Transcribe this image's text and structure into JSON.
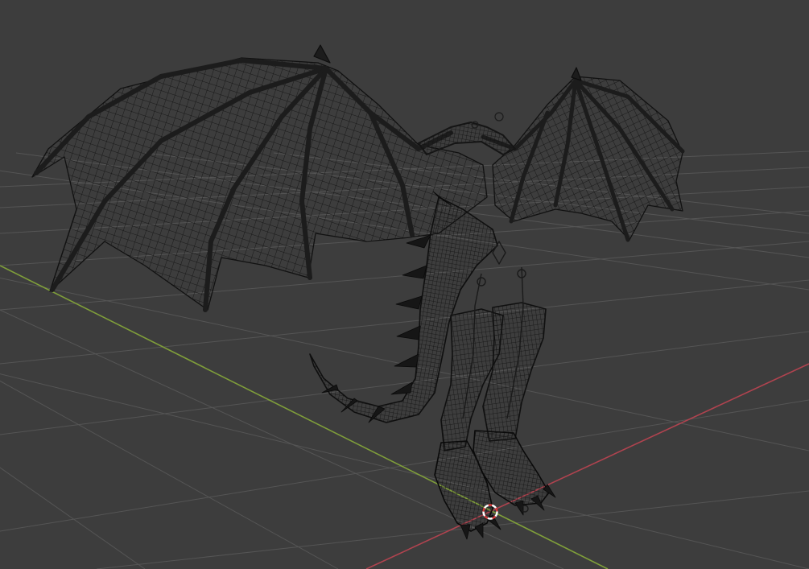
{
  "viewport": {
    "background_color": "#3d3d3d",
    "grid_color": "#555555",
    "axis_x_color": "#b0434f",
    "axis_y_color": "#7f9e3a",
    "wire_color": "#0d0d0d",
    "bone_color": "#1c1c1c",
    "cursor_color_a": "#ffffff",
    "cursor_color_b": "#d83a3a",
    "object_icon": "dragon-wireframe-icon",
    "cursor_icon": "3d-cursor-icon"
  }
}
